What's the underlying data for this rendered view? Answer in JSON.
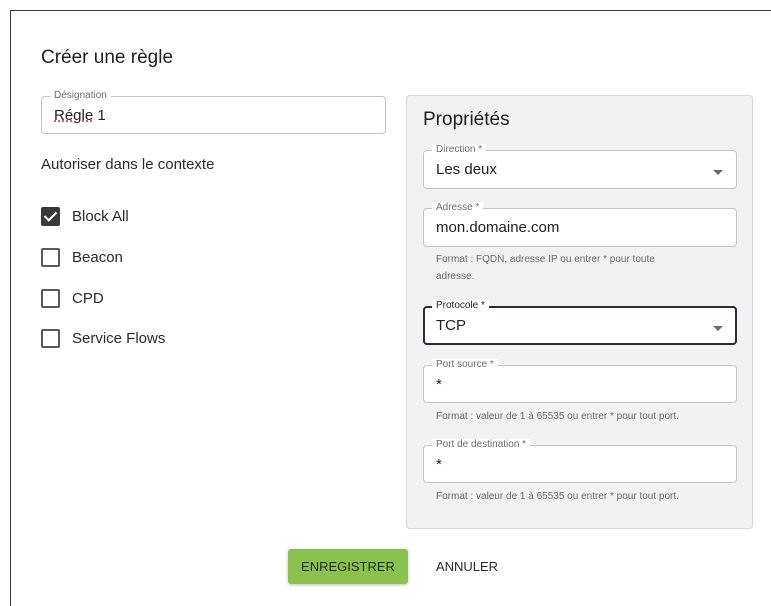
{
  "dialog": {
    "title": "Créer une règle"
  },
  "designation": {
    "label": "Désignation",
    "value_prefix": "Régle",
    "value_suffix": " 1"
  },
  "context": {
    "title": "Autoriser dans le contexte",
    "options": [
      {
        "label": "Block All",
        "checked": true
      },
      {
        "label": "Beacon",
        "checked": false
      },
      {
        "label": "CPD",
        "checked": false
      },
      {
        "label": "Service Flows",
        "checked": false
      }
    ]
  },
  "properties": {
    "title": "Propriétés",
    "direction": {
      "label": "Direction *",
      "value": "Les deux"
    },
    "address": {
      "label": "Adresse *",
      "value": "mon.domaine.com",
      "helper_line1": "Format : FQDN, adresse IP ou entrer * pour toute",
      "helper_line2": "adresse."
    },
    "protocol": {
      "label": "Protocole *",
      "value": "TCP"
    },
    "source_port": {
      "label": "Port source *",
      "value": "*",
      "helper": "Format : valeur de 1 à 65535 ou entrer * pour tout port."
    },
    "dest_port": {
      "label": "Port de destination *",
      "value": "*",
      "helper": "Format : valeur de 1 à 65535 ou entrer * pour tout port."
    }
  },
  "actions": {
    "save": "ENREGISTRER",
    "cancel": "ANNULER"
  },
  "colors": {
    "save_button": "#8bc34a",
    "panel_bg": "#f2f2f2",
    "checkbox_checked": "#3a3a3a"
  },
  "icons": {
    "select_caret": "chevron-down-icon",
    "checkbox_check": "checkmark-icon"
  }
}
